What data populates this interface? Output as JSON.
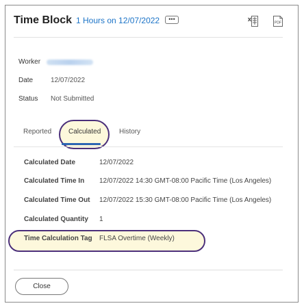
{
  "header": {
    "title": "Time Block",
    "subtitle_link": "1 Hours on 12/07/2022",
    "more_label": "•••",
    "excel_icon": "excel-export-icon",
    "pdf_icon": "pdf-export-icon",
    "pdf_label": "PDF"
  },
  "details": {
    "worker_label": "Worker",
    "date_label": "Date",
    "date_value": "12/07/2022",
    "status_label": "Status",
    "status_value": "Not Submitted"
  },
  "tabs": [
    {
      "label": "Reported",
      "active": false
    },
    {
      "label": "Calculated",
      "active": true
    },
    {
      "label": "History",
      "active": false
    }
  ],
  "calculated": {
    "rows": [
      {
        "label": "Calculated Date",
        "value": "12/07/2022"
      },
      {
        "label": "Calculated Time In",
        "value": "12/07/2022 14:30 GMT-08:00 Pacific Time (Los Angeles)"
      },
      {
        "label": "Calculated Time Out",
        "value": "12/07/2022 15:30 GMT-08:00 Pacific Time (Los Angeles)"
      },
      {
        "label": "Calculated Quantity",
        "value": "1"
      },
      {
        "label": "Time Calculation Tag",
        "value": "FLSA Overtime (Weekly)"
      }
    ]
  },
  "footer": {
    "close_label": "Close"
  },
  "colors": {
    "link": "#1b73c7",
    "highlight_border": "#4b2f7a",
    "highlight_fill": "#fdf8dc",
    "tab_underline": "#2d66b3"
  }
}
